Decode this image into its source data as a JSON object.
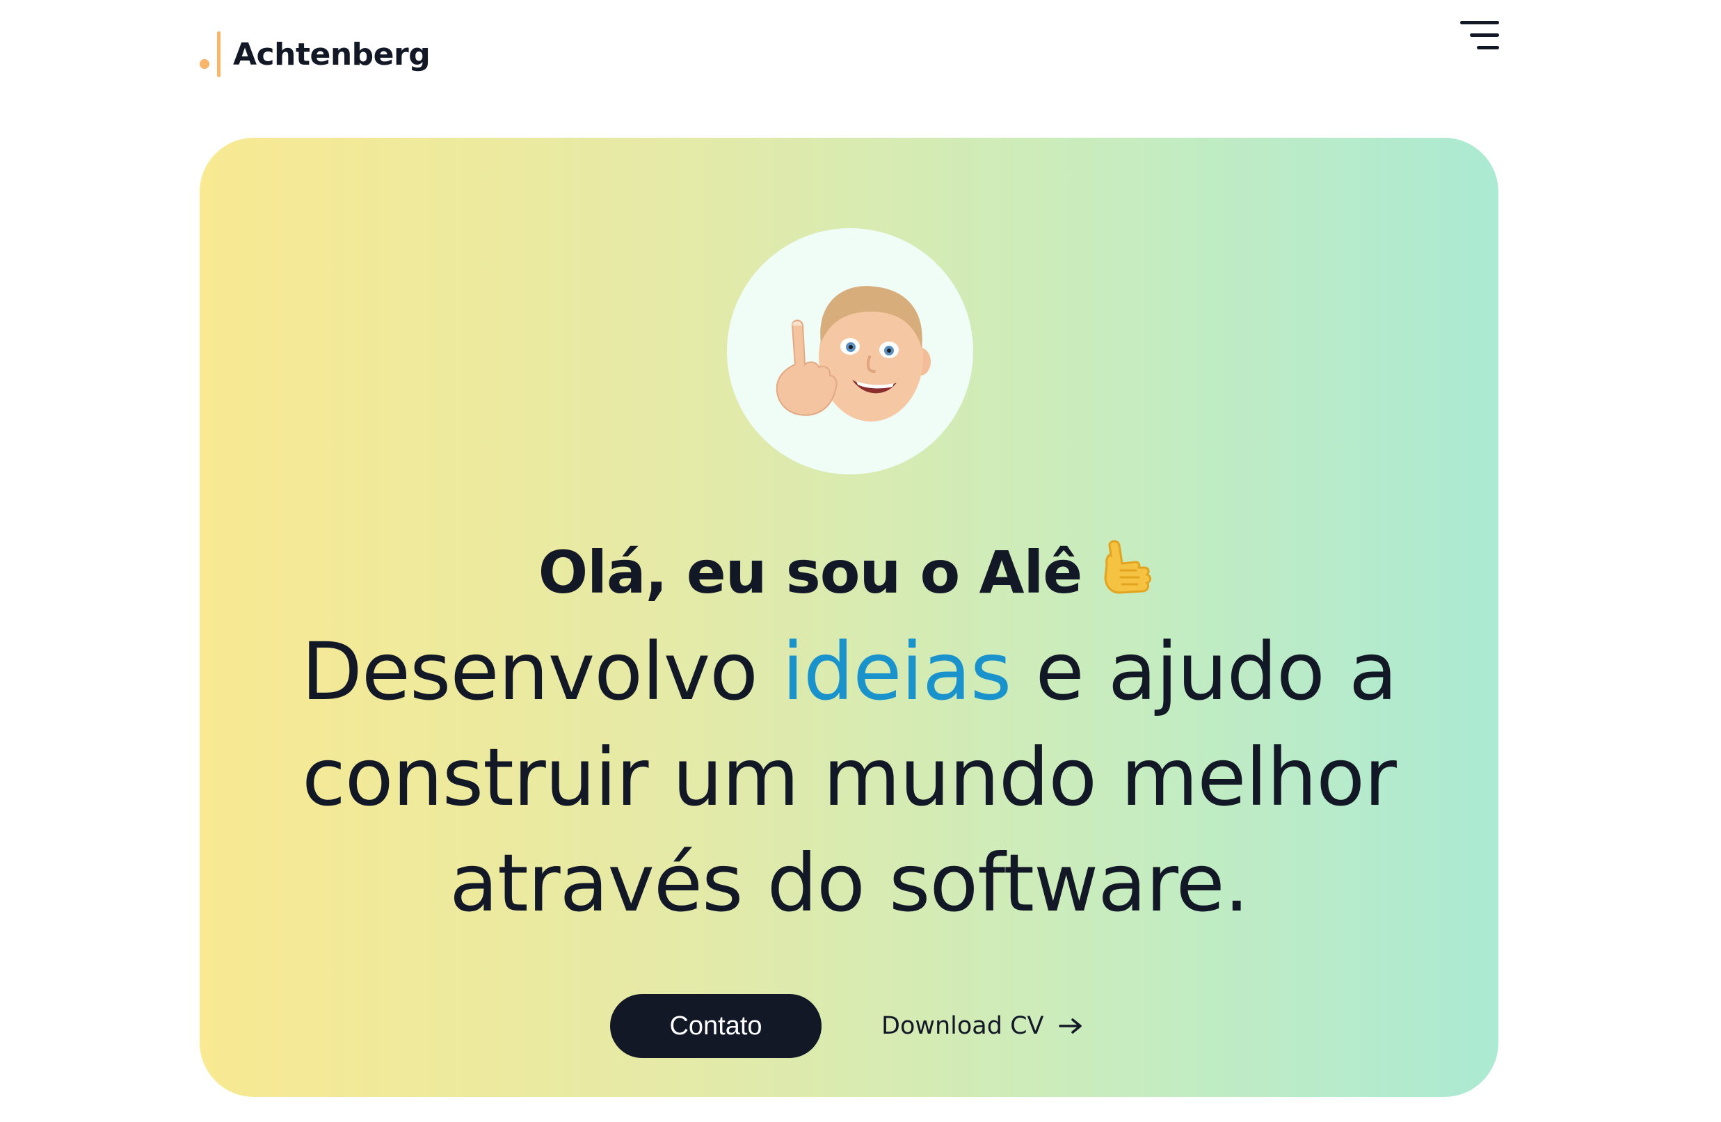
{
  "brand": {
    "name": "Achtenberg",
    "accent_color": "#f9b56a"
  },
  "header": {
    "menu_icon": "hamburger-menu-icon"
  },
  "hero": {
    "avatar_icon": "memoji-pointing-up-icon",
    "greeting": "Olá, eu sou o Alê",
    "greeting_emoji": "call-me-hand-icon",
    "headline_before": "Desenvolvo ",
    "headline_accent": "ideias",
    "headline_after": " e ajudo a construir um mundo melhor através do software.",
    "accent_color": "#1a93cc",
    "gradient": [
      "#f8e992",
      "#abead3"
    ]
  },
  "actions": {
    "contact_label": "Contato",
    "download_label": "Download CV",
    "download_icon": "arrow-right-icon"
  }
}
